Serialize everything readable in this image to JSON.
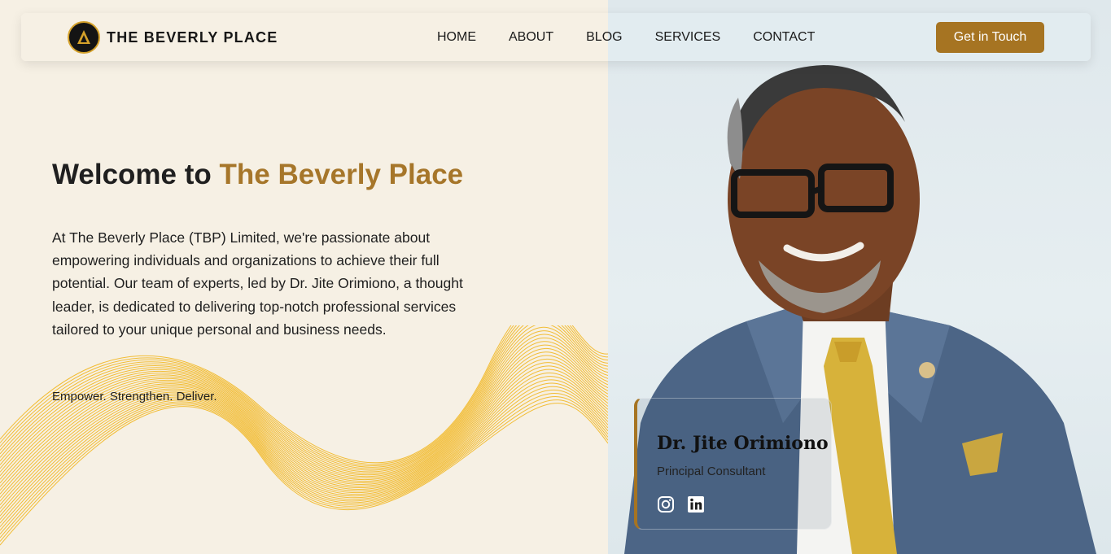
{
  "header": {
    "brand": "THE BEVERLY PLACE",
    "logo_icon": "beverly-place-logo",
    "nav": [
      "HOME",
      "ABOUT",
      "BLOG",
      "SERVICES",
      "CONTACT"
    ],
    "cta": "Get in Touch"
  },
  "hero": {
    "title_prefix": "Welcome to ",
    "title_accent": "The Beverly Place",
    "paragraph": "At The Beverly Place (TBP) Limited, we're passionate about empowering individuals and organizations to achieve their full potential. Our team of experts, led by Dr. Jite Orimiono, a thought leader, is dedicated to delivering top-notch professional services tailored to your unique personal and business needs.",
    "tagline": "Empower. Strengthen. Deliver."
  },
  "profile": {
    "name": "Dr. Jite Orimiono",
    "role": "Principal Consultant",
    "socials": [
      "instagram-icon",
      "linkedin-icon"
    ]
  },
  "colors": {
    "accent": "#a67422",
    "background": "#f6f0e4",
    "wave": "#f2b824"
  }
}
